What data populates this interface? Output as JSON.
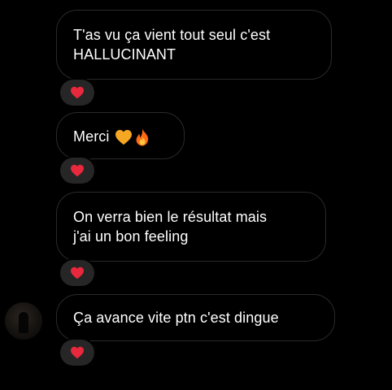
{
  "messages": [
    {
      "lines": [
        "T'as vu ça vient tout seul c'est",
        "HALLUCINANT"
      ],
      "emojis": [],
      "reaction": "red-heart"
    },
    {
      "lines": [
        "Merci"
      ],
      "emojis": [
        "orange-heart",
        "fire"
      ],
      "reaction": "red-heart"
    },
    {
      "lines": [
        "On verra bien le résultat mais",
        "j'ai un bon feeling"
      ],
      "emojis": [],
      "reaction": "red-heart"
    },
    {
      "lines": [
        "Ça avance vite ptn c'est dingue"
      ],
      "emojis": [],
      "reaction": "red-heart"
    }
  ],
  "colors": {
    "background": "#000000",
    "bubble_border": "#2a2a2a",
    "text": "#ffffff",
    "reaction_pill": "#262626",
    "red_heart": "#e8283c",
    "orange_heart": "#f5a623",
    "fire": "#ff6a13"
  },
  "icons": {
    "avatar": "contact-avatar",
    "reaction": "red-heart-icon"
  }
}
